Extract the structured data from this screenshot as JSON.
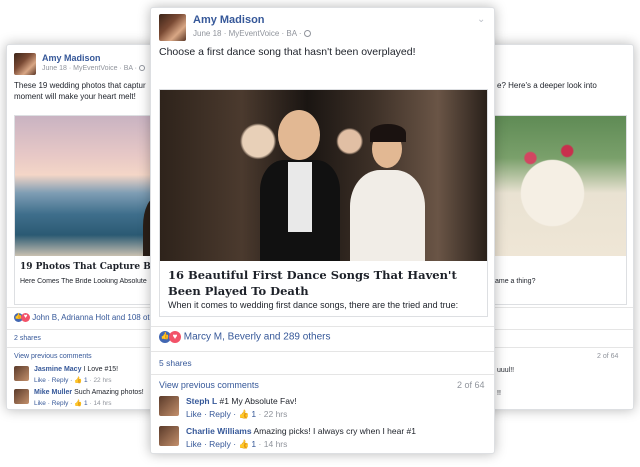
{
  "left_card": {
    "author": "Amy Madison",
    "meta": "June 18 · MyEventVoice · BA ·",
    "text": "These 19 wedding photos that captur moment will make your heart melt!",
    "link_title": "19 Photos That Capture Brid",
    "link_desc": "Here Comes The Bride Looking Absolute",
    "reactions": "John B, Adrianna Holt and 108 other",
    "shares": "2 shares",
    "view_prev": "View previous comments",
    "comments": [
      {
        "name": "Jasmine Macy",
        "text": "I Love #15!",
        "actions": "Like · Reply ·",
        "likes": "1",
        "time": "22 hrs"
      },
      {
        "name": "Mike Muller",
        "text": "Such Amazing photos!",
        "actions": "Like · Reply ·",
        "likes": "1",
        "time": "14 hrs"
      }
    ]
  },
  "right_card": {
    "text": "e? Here's a deeper look into",
    "link_desc": "ame a thing?",
    "count": "2 of 64",
    "snippet1": "uuul!!",
    "snippet2": "!!"
  },
  "main_card": {
    "author": "Amy Madison",
    "meta": "June 18 · MyEventVoice · BA ·",
    "text": "Choose a first dance song that hasn't been overplayed!",
    "link_title": "16 Beautiful First Dance Songs That Haven't Been Played To Death",
    "link_desc": "When it comes to wedding first dance songs, there are the tried and true:",
    "reactions": "Marcy M, Beverly and 289 others",
    "shares": "5 shares",
    "view_prev": "View previous comments",
    "count": "2 of 64",
    "comments": [
      {
        "name": "Steph L",
        "text": "#1 My Absolute Fav!",
        "actions": "Like · Reply ·",
        "likes": "1",
        "time": "22 hrs"
      },
      {
        "name": "Charlie Williams",
        "text": "Amazing picks! I always cry when I hear #1",
        "actions": "Like · Reply ·",
        "likes": "1",
        "time": "14 hrs"
      }
    ]
  },
  "icons": {
    "like": "thumbs-up-icon",
    "love": "heart-icon",
    "globe": "globe-icon",
    "chevron": "chevron-down-icon"
  },
  "colors": {
    "link_blue": "#365899",
    "like_blue": "#4267b2",
    "love_red": "#f25268",
    "meta_gray": "#90949c"
  }
}
